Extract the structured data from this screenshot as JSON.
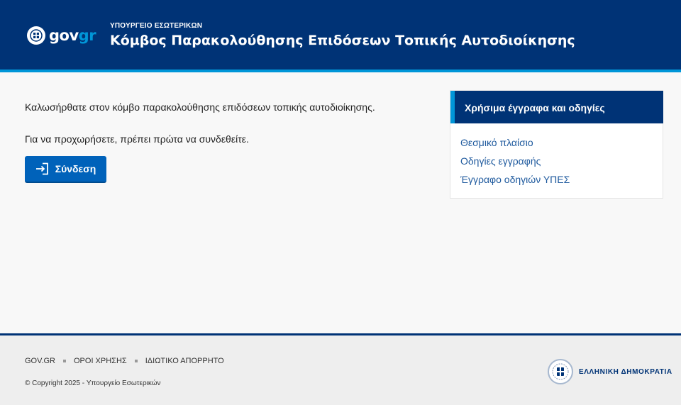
{
  "header": {
    "logo": {
      "prefix": "gov",
      "suffix": "gr"
    },
    "ministry": "ΥΠΟΥΡΓΕΙΟ ΕΣΩΤΕΡΙΚΩΝ",
    "title": "Κόμβος Παρακολούθησης Επιδόσεων Τοπικής Αυτοδιοίκησης"
  },
  "main": {
    "welcome": "Καλωσήρθατε στον κόμβο παρακολούθησης επιδόσεων τοπικής αυτοδιοίκησης.",
    "proceed": "Για να προχωρήσετε, πρέπει πρώτα να συνδεθείτε.",
    "login_label": "Σύνδεση",
    "login_icon": "login-icon"
  },
  "sidebar": {
    "title": "Χρήσιμα έγγραφα και οδηγίες",
    "links": [
      {
        "label": "Θεσμικό πλαίσιο"
      },
      {
        "label": "Οδηγίες εγγραφής"
      },
      {
        "label": "Έγγραφο οδηγιών ΥΠΕΣ"
      }
    ]
  },
  "footer": {
    "links": [
      {
        "label": "GOV.GR"
      },
      {
        "label": "ΟΡΟΙ ΧΡΗΣΗΣ"
      },
      {
        "label": "ΙΔΙΩΤΙΚΟ ΑΠΟΡΡΗΤΟ"
      }
    ],
    "copyright": "© Copyright 2025 - Υπουργείο Εσωτερικών",
    "hellenic_republic": "ΕΛΛΗΝΙΚΗ ΔΗΜΟΚΡΑΤΙΑ"
  },
  "colors": {
    "primary": "#003376",
    "accent": "#0096d8",
    "button": "#0062ba",
    "link": "#1f5a9e"
  }
}
